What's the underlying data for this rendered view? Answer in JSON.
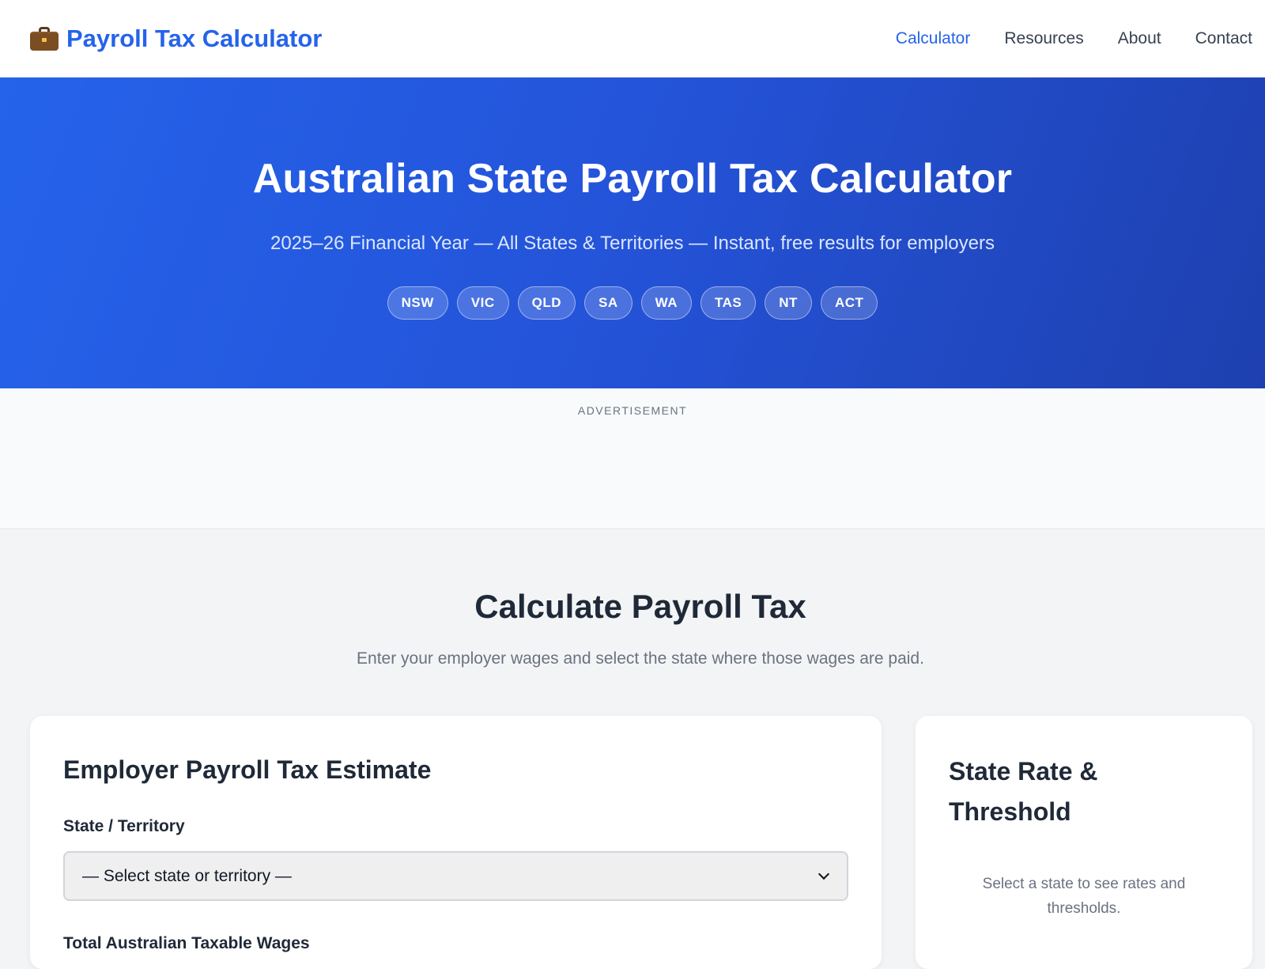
{
  "header": {
    "brand": "Payroll Tax Calculator",
    "brand_icon": "briefcase-icon",
    "nav": [
      {
        "label": "Calculator",
        "active": true
      },
      {
        "label": "Resources",
        "active": false
      },
      {
        "label": "About",
        "active": false
      },
      {
        "label": "Contact",
        "active": false
      }
    ]
  },
  "hero": {
    "title": "Australian State Payroll Tax Calculator",
    "subtitle": "2025–26 Financial Year — All States & Territories — Instant, free results for employers",
    "states": [
      "NSW",
      "VIC",
      "QLD",
      "SA",
      "WA",
      "TAS",
      "NT",
      "ACT"
    ]
  },
  "ad": {
    "label": "ADVERTISEMENT"
  },
  "calculator": {
    "title": "Calculate Payroll Tax",
    "subtitle": "Enter your employer wages and select the state where those wages are paid.",
    "form": {
      "heading": "Employer Payroll Tax Estimate",
      "state_label": "State / Territory",
      "state_value": "— Select state or territory —",
      "wages_label": "Total Australian Taxable Wages"
    },
    "side": {
      "heading": "State Rate & Threshold",
      "hint": "Select a state to see rates and thresholds."
    }
  },
  "colors": {
    "accent": "#2563eb",
    "hero_start": "#2563eb",
    "hero_end": "#1e40af",
    "page_bg": "#f3f4f6"
  }
}
